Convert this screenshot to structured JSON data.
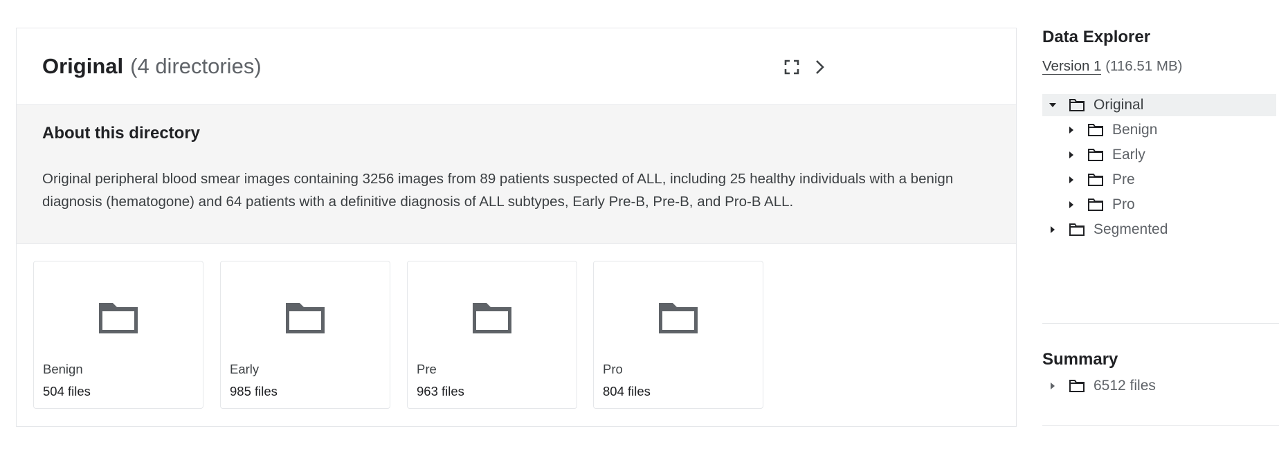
{
  "panel": {
    "title": "Original",
    "count": "(4 directories)",
    "about_heading": "About this directory",
    "about_text": "Original peripheral blood smear images containing 3256 images from 89 patients suspected of ALL, including 25 healthy individuals with a benign diagnosis (hematogone) and 64 patients with a definitive diagnosis of ALL subtypes, Early Pre-B, Pre-B, and Pro-B ALL.",
    "cards": [
      {
        "name": "Benign",
        "files": "504 files"
      },
      {
        "name": "Early",
        "files": "985 files"
      },
      {
        "name": "Pre",
        "files": "963 files"
      },
      {
        "name": "Pro",
        "files": "804 files"
      }
    ]
  },
  "sidebar": {
    "title": "Data Explorer",
    "version_link": "Version 1",
    "version_size": "(116.51 MB)",
    "tree": [
      {
        "label": "Original",
        "expanded": true,
        "level": 0,
        "selected": true
      },
      {
        "label": "Benign",
        "expanded": false,
        "level": 1
      },
      {
        "label": "Early",
        "expanded": false,
        "level": 1
      },
      {
        "label": "Pre",
        "expanded": false,
        "level": 1
      },
      {
        "label": "Pro",
        "expanded": false,
        "level": 1
      },
      {
        "label": "Segmented",
        "expanded": false,
        "level": 0
      }
    ],
    "summary_title": "Summary",
    "summary_item": "6512 files"
  }
}
